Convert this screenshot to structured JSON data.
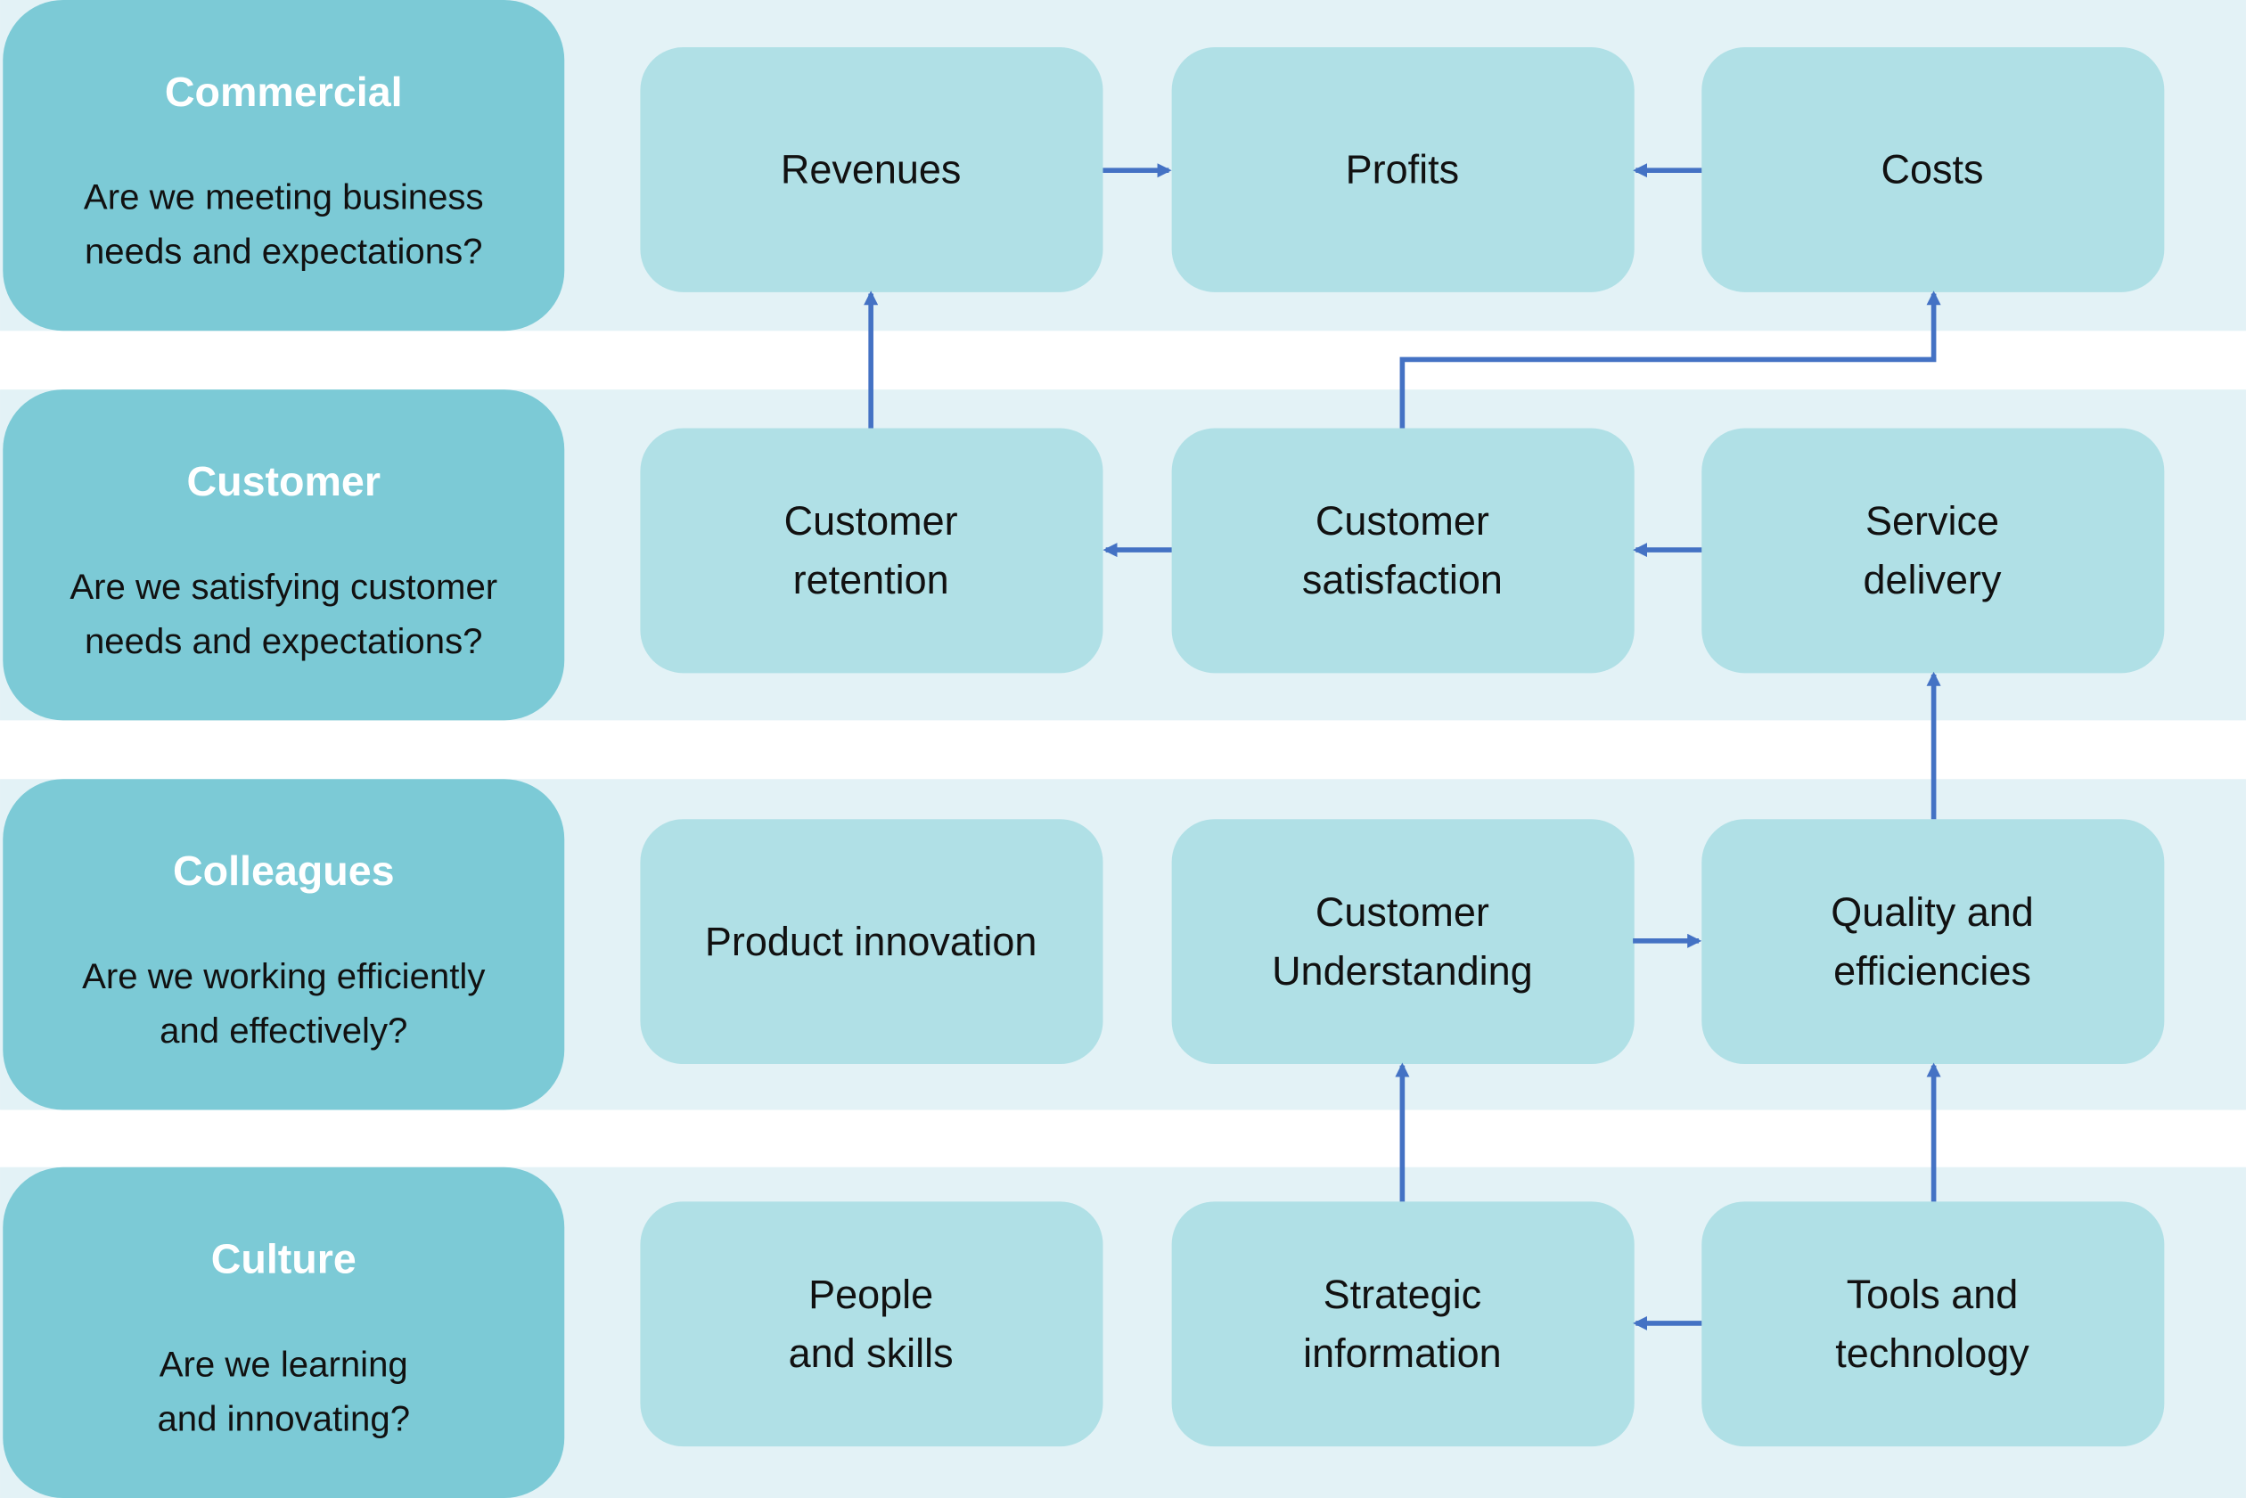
{
  "colors": {
    "band": "#e3f2f6",
    "header": "#7ccad6",
    "box": "#b0e0e6",
    "arrow": "#4472c4"
  },
  "rows": [
    {
      "title": "Commercial",
      "question": [
        "Are we meeting business",
        "needs and expectations?"
      ],
      "boxes": [
        [
          "Revenues"
        ],
        [
          "Profits"
        ],
        [
          "Costs"
        ]
      ]
    },
    {
      "title": "Customer",
      "question": [
        "Are we satisfying customer",
        "needs and expectations?"
      ],
      "boxes": [
        [
          "Customer",
          "retention"
        ],
        [
          "Customer",
          "satisfaction"
        ],
        [
          "Service",
          "delivery"
        ]
      ]
    },
    {
      "title": "Colleagues",
      "question": [
        "Are we working efficiently",
        "and effectively?"
      ],
      "boxes": [
        [
          "Product innovation"
        ],
        [
          "Customer",
          "Understanding"
        ],
        [
          "Quality and",
          "efficiencies"
        ]
      ]
    },
    {
      "title": "Culture",
      "question": [
        "Are we learning",
        "and innovating?"
      ],
      "boxes": [
        [
          "People",
          "and skills"
        ],
        [
          "Strategic",
          "information"
        ],
        [
          "Tools and",
          "technology"
        ]
      ]
    }
  ],
  "connections": [
    {
      "from": "Revenues",
      "to": "Profits"
    },
    {
      "from": "Costs",
      "to": "Profits"
    },
    {
      "from": "Customer retention",
      "to": "Revenues"
    },
    {
      "from": "Customer satisfaction",
      "to": "Costs"
    },
    {
      "from": "Customer satisfaction",
      "to": "Customer retention"
    },
    {
      "from": "Service delivery",
      "to": "Customer satisfaction"
    },
    {
      "from": "Quality and efficiencies",
      "to": "Service delivery"
    },
    {
      "from": "Customer Understanding",
      "to": "Quality and efficiencies"
    },
    {
      "from": "Strategic information",
      "to": "Customer Understanding"
    },
    {
      "from": "Tools and technology",
      "to": "Quality and efficiencies"
    },
    {
      "from": "Tools and technology",
      "to": "Strategic information"
    }
  ]
}
